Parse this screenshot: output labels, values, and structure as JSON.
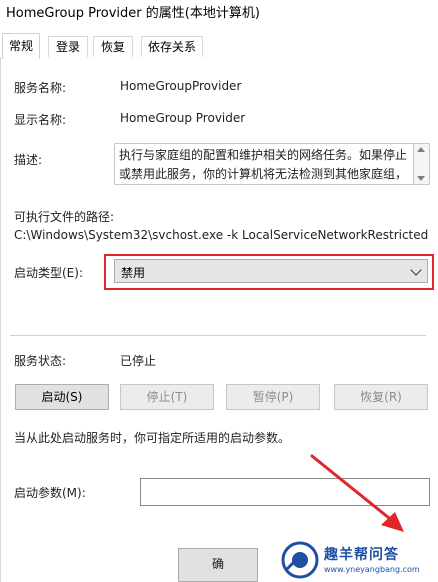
{
  "window": {
    "title": "HomeGroup Provider 的属性(本地计算机)"
  },
  "tabs": [
    {
      "label": "常规"
    },
    {
      "label": "登录"
    },
    {
      "label": "恢复"
    },
    {
      "label": "依存关系"
    }
  ],
  "general": {
    "service_name_label": "服务名称:",
    "service_name": "HomeGroupProvider",
    "display_name_label": "显示名称:",
    "display_name": "HomeGroup Provider",
    "description_label": "描述:",
    "description": "执行与家庭组的配置和维护相关的网络任务。如果停止或禁用此服务，你的计算机将无法检测到其他家庭组，",
    "path_label": "可执行文件的路径:",
    "path": "C:\\Windows\\System32\\svchost.exe -k LocalServiceNetworkRestricted",
    "startup_type_label": "启动类型(E):",
    "startup_type_value": "禁用",
    "status_label": "服务状态:",
    "status_value": "已停止",
    "buttons": {
      "start": "启动(S)",
      "stop": "停止(T)",
      "pause": "暂停(P)",
      "resume": "恢复(R)"
    },
    "hint": "当从此处启动服务时，你可指定所适用的启动参数。",
    "params_label": "启动参数(M):",
    "params_value": ""
  },
  "footer": {
    "ok_label": "确"
  },
  "watermark": {
    "text": "趣羊帮问答",
    "url": "www.yneyangbang.com",
    "accent": "#1e4fa3"
  },
  "colors": {
    "highlight": "#e0262b",
    "arrow": "#e0262b"
  }
}
